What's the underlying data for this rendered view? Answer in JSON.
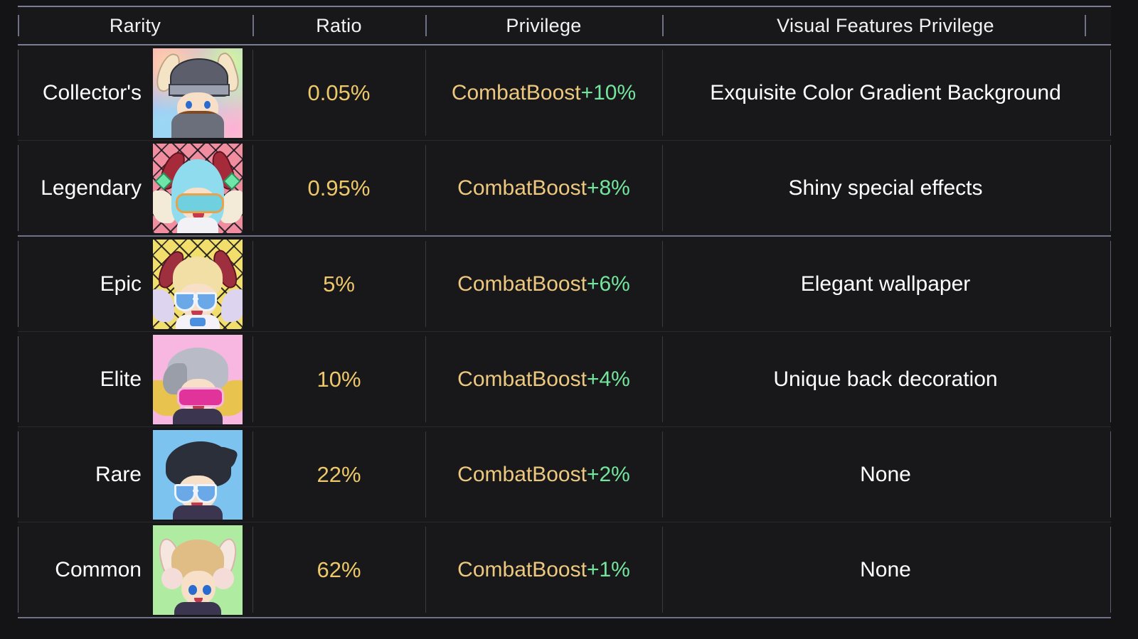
{
  "table": {
    "columns": [
      {
        "key": "rarity",
        "label": "Rarity"
      },
      {
        "key": "ratio",
        "label": "Ratio"
      },
      {
        "key": "privilege",
        "label": "Privilege"
      },
      {
        "key": "visual",
        "label": "Visual Features Privilege"
      }
    ],
    "rows": [
      {
        "rarity": "Collector's",
        "avatar": "viking-rainbow-avatar",
        "ratio": "0.05%",
        "privilege_base": "CombatBoost",
        "privilege_bonus": "+10%",
        "visual": "Exquisite Color Gradient Background"
      },
      {
        "rarity": "Legendary",
        "avatar": "blue-hair-demon-avatar",
        "ratio": "0.95%",
        "privilege_base": "CombatBoost",
        "privilege_bonus": "+8%",
        "visual": "Shiny special effects"
      },
      {
        "rarity": "Epic",
        "avatar": "blonde-demon-angel-avatar",
        "ratio": "5%",
        "privilege_base": "CombatBoost",
        "privilege_bonus": "+6%",
        "visual": "Elegant wallpaper"
      },
      {
        "rarity": "Elite",
        "avatar": "silver-hair-visor-avatar",
        "ratio": "10%",
        "privilege_base": "CombatBoost",
        "privilege_bonus": "+4%",
        "visual": "Unique back decoration"
      },
      {
        "rarity": "Rare",
        "avatar": "black-hair-heart-glasses-avatar",
        "ratio": "22%",
        "privilege_base": "CombatBoost",
        "privilege_bonus": "+2%",
        "visual": "None"
      },
      {
        "rarity": "Common",
        "avatar": "bunny-ear-blonde-avatar",
        "ratio": "62%",
        "privilege_base": "CombatBoost",
        "privilege_bonus": "+1%",
        "visual": "None"
      }
    ]
  },
  "colors": {
    "page_background": "#141416",
    "table_background": "#18181a",
    "header_text": "#f2f2f4",
    "header_rule": "#7b7d93",
    "ratio_text": "#edc86a",
    "privilege_base_text": "#edc87f",
    "privilege_bonus_text": "#74e59d",
    "visual_text": "#ffffff",
    "column_divider": "#3a3a42",
    "edge_divider": "#5d5f72"
  }
}
